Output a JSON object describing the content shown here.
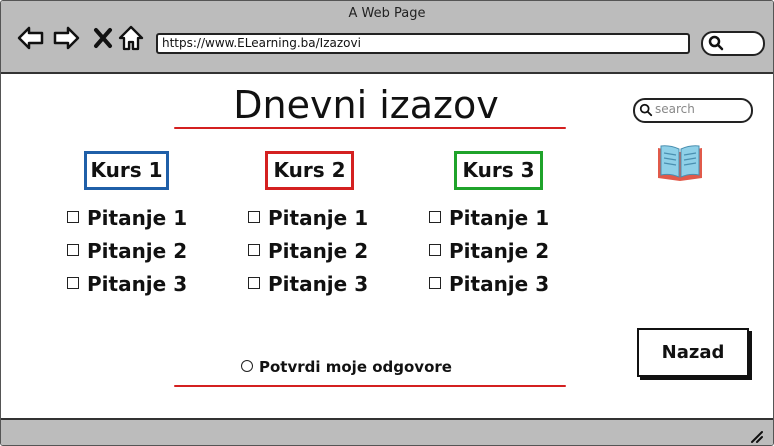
{
  "window": {
    "title": "A Web Page"
  },
  "browser": {
    "url": "https://www.ELearning.ba/Izazovi",
    "nav_icons": [
      "back-arrow-icon",
      "forward-arrow-icon",
      "close-x-icon",
      "home-icon"
    ]
  },
  "page": {
    "heading": "Dnevni izazov",
    "search_placeholder": "search",
    "book_icon": "open-book-icon",
    "courses": [
      {
        "label": "Kurs 1",
        "color": "#1f5fa8",
        "questions": [
          "Pitanje 1",
          "Pitanje 2",
          "Pitanje 3"
        ]
      },
      {
        "label": "Kurs 2",
        "color": "#d42020",
        "questions": [
          "Pitanje 1",
          "Pitanje 2",
          "Pitanje 3"
        ]
      },
      {
        "label": "Kurs 3",
        "color": "#1fa32a",
        "questions": [
          "Pitanje 1",
          "Pitanje 2",
          "Pitanje 3"
        ]
      }
    ],
    "confirm_label": "Potvrdi moje odgovore",
    "back_button": "Nazad"
  },
  "colors": {
    "accent_line": "#d42020",
    "chrome": "#bcbcbc"
  }
}
